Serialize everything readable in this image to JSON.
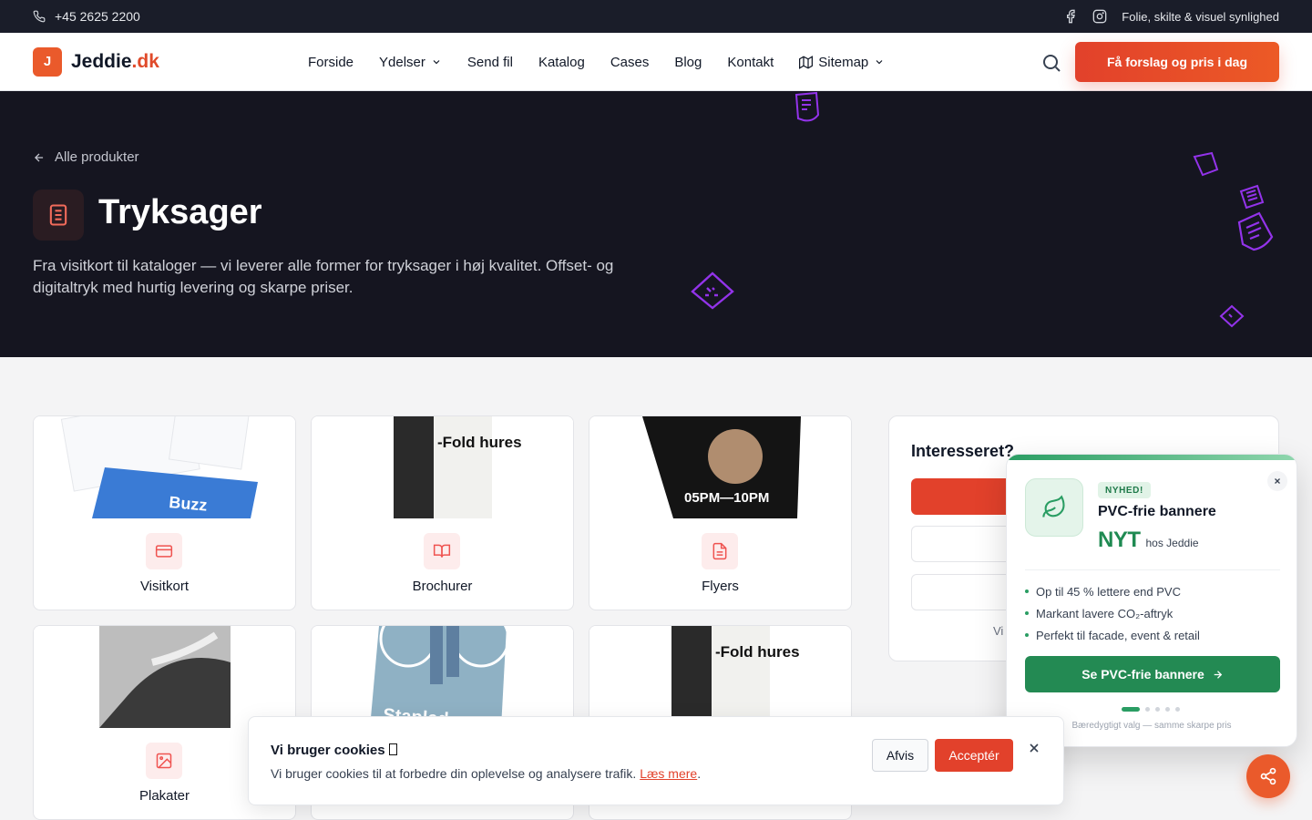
{
  "topbar": {
    "phone": "+45 2625 2200",
    "tagline": "Folie, skilte & visuel synlighed",
    "icons": [
      "phone-icon",
      "facebook-icon",
      "instagram-icon"
    ]
  },
  "header": {
    "logo_letter": "J",
    "logo_name": "Jeddie",
    "logo_tld": ".dk",
    "nav": [
      {
        "label": "Forside"
      },
      {
        "label": "Ydelser"
      },
      {
        "label": "Send fil"
      },
      {
        "label": "Katalog"
      },
      {
        "label": "Cases"
      },
      {
        "label": "Blog"
      },
      {
        "label": "Kontakt"
      },
      {
        "label": "Sitemap"
      }
    ],
    "cta": "Få forslag og pris i dag"
  },
  "hero": {
    "back_label": "Alle produkter",
    "title": "Tryksager",
    "description": "Fra visitkort til kataloger — vi leverer alle former for tryksager i høj kvalitet. Offset- og digitaltryk med hurtig levering og skarpe priser."
  },
  "products": [
    {
      "label": "Visitkort",
      "icon": "credit-card-icon",
      "image_text": "Buzz"
    },
    {
      "label": "Brochurer",
      "icon": "book-open-icon",
      "image_text": "-Fold hures"
    },
    {
      "label": "Flyers",
      "icon": "file-text-icon",
      "image_text": "05PM—10PM"
    },
    {
      "label": "Plakater",
      "icon": "image-icon",
      "image_text": ""
    },
    {
      "label": "",
      "icon": "",
      "image_text": "Stapled"
    },
    {
      "label": "",
      "icon": "",
      "image_text": "-Fold hures"
    }
  ],
  "sidebar": {
    "title": "Interesseret?",
    "note": "Vi"
  },
  "promo": {
    "badge": "NYHED!",
    "title": "PVC-frie bannere",
    "nyt_big": "NYT",
    "nyt_small": "hos Jeddie",
    "bullets": [
      "Op til 45 % lettere end PVC",
      "Markant lavere CO₂-aftryk",
      "Perfekt til facade, event & retail"
    ],
    "button": "Se PVC-frie bannere",
    "footer": "Bæredygtigt valg — samme skarpe pris",
    "slides": 5,
    "active_slide": 1,
    "accent": "#238a53"
  },
  "cookie": {
    "title": "Vi bruger cookies",
    "text": "Vi bruger cookies til at forbedre din oplevelse og analysere trafik.",
    "link": "Læs mere",
    "decline": "Afvis",
    "accept": "Acceptér"
  },
  "colors": {
    "brand": "#e2412b",
    "hero_bg": "#151520",
    "topbar_bg": "#1a1d29",
    "green": "#238a53"
  }
}
